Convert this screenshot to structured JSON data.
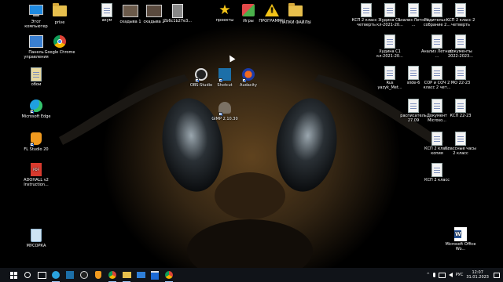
{
  "desktop": {
    "icons": [
      {
        "label": "Этот компьютер",
        "icon": "this-pc-icon"
      },
      {
        "label": "prive",
        "icon": "folder-icon"
      },
      {
        "label": "акум",
        "icon": "document-icon"
      },
      {
        "label": "скадыва 1",
        "icon": "image-icon"
      },
      {
        "label": "скадыва 2",
        "icon": "image-icon"
      },
      {
        "label": "2b6c1b27e3...",
        "icon": "image-icon"
      },
      {
        "label": "проекты",
        "icon": "star-folder-icon"
      },
      {
        "label": "Игры",
        "icon": "games-icon"
      },
      {
        "label": "ПРОГРАММЫ",
        "icon": "warning-icon"
      },
      {
        "label": "ПАПКИ ФАЙЛЫ",
        "icon": "folder-icon"
      },
      {
        "label": "Панель управления",
        "icon": "control-panel-icon"
      },
      {
        "label": "Google Chrome",
        "icon": "chrome-icon"
      },
      {
        "label": "обои",
        "icon": "wallpaper-icon"
      },
      {
        "label": "OBS-Studio",
        "icon": "obs-icon"
      },
      {
        "label": "Shotcut",
        "icon": "shotcut-icon"
      },
      {
        "label": "Audacity",
        "icon": "audacity-icon"
      },
      {
        "label": "GIMP 2.10.30",
        "icon": "gimp-icon"
      },
      {
        "label": "Microsoft Edge",
        "icon": "edge-icon"
      },
      {
        "label": "FL Studio 20",
        "icon": "fl-studio-icon"
      },
      {
        "label": "ADOHALL v2 Instruction...",
        "icon": "pdf-icon"
      },
      {
        "label": "МУСОРКА",
        "icon": "recycle-bin-icon"
      },
      {
        "label": "КСП 2 класс 3 четверть",
        "icon": "document-icon"
      },
      {
        "label": "Худина С1 кл-2021-20...",
        "icon": "document-icon"
      },
      {
        "label": "Анализ Летний ...",
        "icon": "document-icon"
      },
      {
        "label": "Родительс... собрание 2...",
        "icon": "document-icon"
      },
      {
        "label": "КСП 2 класс 2 четверть",
        "icon": "document-icon"
      },
      {
        "label": "Худина С1 кл-2021-20...",
        "icon": "document-icon"
      },
      {
        "label": "Анализ Летний ...",
        "icon": "document-icon"
      },
      {
        "label": "документы 2022-2023...",
        "icon": "document-icon"
      },
      {
        "label": "Rus yazyk_Met...",
        "icon": "document-icon"
      },
      {
        "label": "slide-6",
        "icon": "document-icon"
      },
      {
        "label": "СОР и СОЧ 2 класс 2 чет...",
        "icon": "document-icon"
      },
      {
        "label": "МО 22-23",
        "icon": "document-icon"
      },
      {
        "label": "расписатель 27.09",
        "icon": "document-icon"
      },
      {
        "label": "Документ Microso...",
        "icon": "document-icon"
      },
      {
        "label": "КСП 22-23",
        "icon": "document-icon"
      },
      {
        "label": "КСП 2 класс копия",
        "icon": "document-icon"
      },
      {
        "label": "Классные часы 2 класс",
        "icon": "document-icon"
      },
      {
        "label": "КСП 2 класс",
        "icon": "document-icon"
      },
      {
        "label": "Microsoft Office Wo...",
        "icon": "word-icon"
      }
    ]
  },
  "taskbar": {
    "icons": [
      "windows-start-icon",
      "search-icon",
      "task-view-icon",
      "telegram-icon",
      "shotcut-icon",
      "obs-icon",
      "fl-studio-icon",
      "chrome-icon",
      "file-explorer-icon",
      "mail-icon",
      "store-icon",
      "chrome-icon"
    ],
    "lang": "РУС",
    "time": "12:07",
    "date": "31.01.2023"
  }
}
